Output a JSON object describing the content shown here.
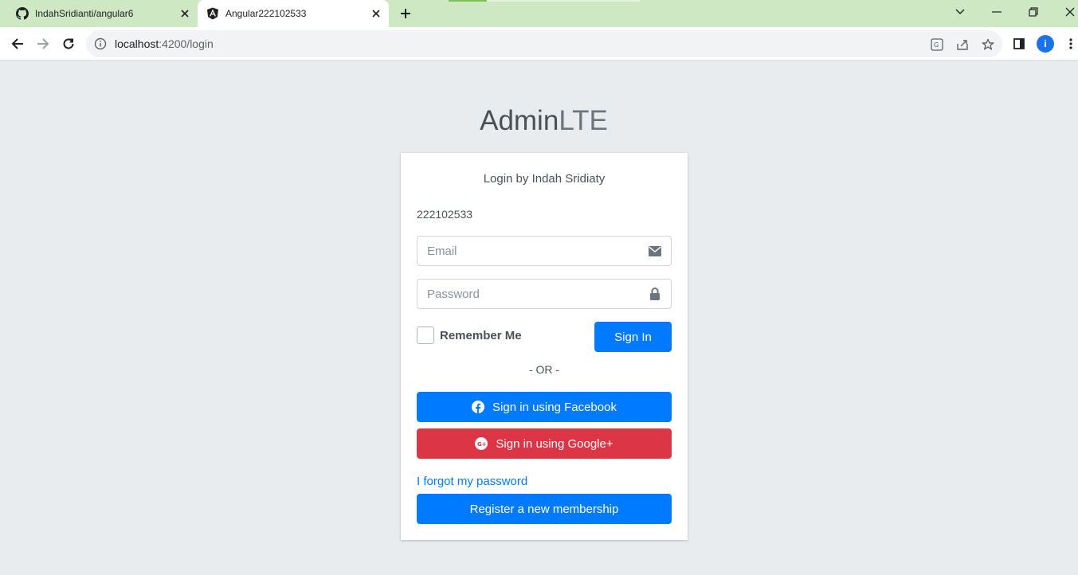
{
  "browser": {
    "tabs": [
      {
        "title": "IndahSridianti/angular6",
        "icon": "github-icon",
        "active": false
      },
      {
        "title": "Angular222102533",
        "icon": "angular-icon",
        "active": true
      }
    ],
    "url": {
      "host": "localhost",
      "path": ":4200/login"
    },
    "profile_initial": "i",
    "load_progress": 0.2
  },
  "page": {
    "logo": {
      "bold": "Admin",
      "light": "LTE"
    },
    "login_message": "Login by Indah Sridiaty",
    "nim": "222102533",
    "email_placeholder": "Email",
    "password_placeholder": "Password",
    "remember_label": "Remember Me",
    "signin_label": "Sign In",
    "or_text": "- OR -",
    "facebook_label": "Sign in using Facebook",
    "google_label": "Sign in using Google+",
    "forgot_label": "I forgot my password",
    "register_label": "Register a new membership"
  },
  "colors": {
    "primary": "#007bff",
    "danger": "#dc3545",
    "page_bg": "#e9ecef",
    "tabbar_bg": "#cfe8c4"
  }
}
